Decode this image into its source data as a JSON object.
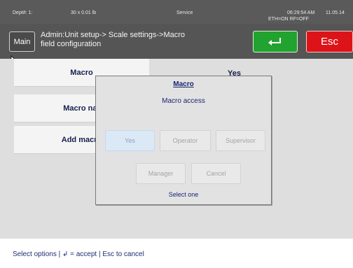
{
  "status_bar": {
    "dept": "Dept#: 1:",
    "weight": "30 x 0.01 lb",
    "mode": "Service",
    "network": "ETH=ON  RF=OFF",
    "time": "06:29:54 AM",
    "date": "11.05.14"
  },
  "title_bar": {
    "main_label": "Main",
    "title_line1": "Admin:Unit setup-> Scale settings->Macro",
    "title_line2": "field configuration",
    "accept_icon": "enter-arrow-icon",
    "esc_label": "Esc",
    "accept_color": "#22a22e",
    "esc_color": "#dc1419"
  },
  "rows": [
    {
      "label": "Macro",
      "value": "Yes"
    },
    {
      "label": "Macro nar"
    },
    {
      "label": "Add macro"
    }
  ],
  "dialog": {
    "title": "Macro",
    "subtitle": "Macro access",
    "buttons": [
      "Yes",
      "Operator",
      "Supervisor",
      "Manager",
      "Cancel"
    ],
    "selected": "Yes",
    "footer": "Select one"
  },
  "footer": {
    "hint": "Select options | ↲ = accept | Esc to cancel"
  }
}
